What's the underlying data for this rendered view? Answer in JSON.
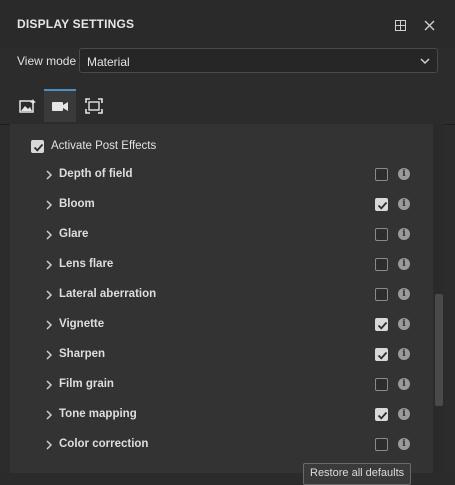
{
  "header": {
    "title": "DISPLAY SETTINGS"
  },
  "view_mode": {
    "label": "View mode",
    "value": "Material"
  },
  "activate_post_effects": {
    "label": "Activate Post Effects",
    "checked": true
  },
  "effects": [
    {
      "label": "Depth of field",
      "checked": false
    },
    {
      "label": "Bloom",
      "checked": true
    },
    {
      "label": "Glare",
      "checked": false
    },
    {
      "label": "Lens flare",
      "checked": false
    },
    {
      "label": "Lateral aberration",
      "checked": false
    },
    {
      "label": "Vignette",
      "checked": true
    },
    {
      "label": "Sharpen",
      "checked": true
    },
    {
      "label": "Film grain",
      "checked": false
    },
    {
      "label": "Tone mapping",
      "checked": true
    },
    {
      "label": "Color correction",
      "checked": false
    }
  ],
  "restore_button": {
    "label": "Restore all defaults"
  },
  "colors": {
    "active_tab_accent": "#4a90c6",
    "panel_bg": "#333333"
  }
}
